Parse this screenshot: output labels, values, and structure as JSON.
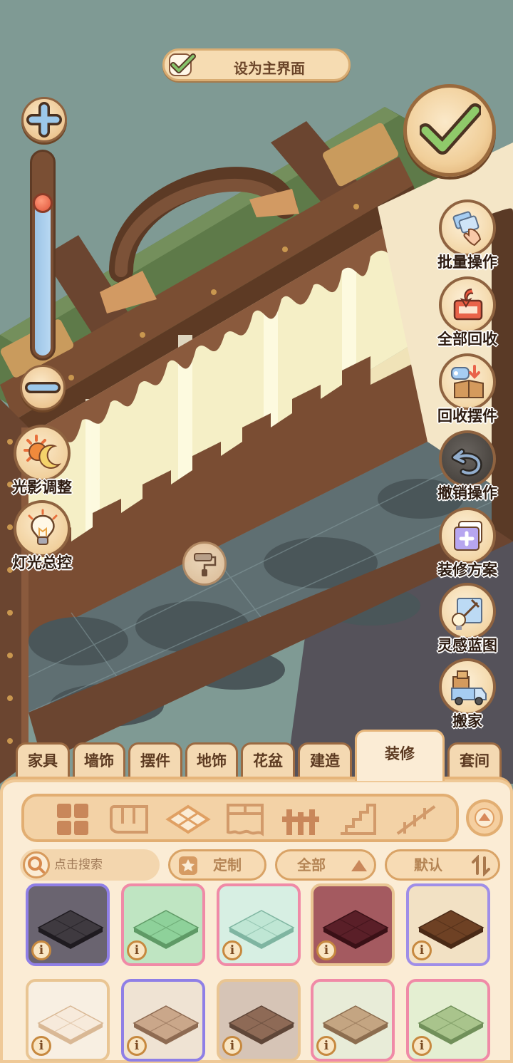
{
  "header": {
    "set_main_label": "设为主界面"
  },
  "zoom": {
    "level": 0.78
  },
  "left_tools": [
    {
      "label": "光影调整",
      "icon": "sun-moon-icon"
    },
    {
      "label": "灯光总控",
      "icon": "lightbulb-icon"
    }
  ],
  "right_tools": [
    {
      "label": "批量操作",
      "icon": "batch-hand-icon"
    },
    {
      "label": "全部回收",
      "icon": "recycle-all-icon"
    },
    {
      "label": "回收摆件",
      "icon": "recycle-decor-icon"
    },
    {
      "label": "撤销操作",
      "icon": "undo-icon"
    },
    {
      "label": "装修方案",
      "icon": "plan-card-icon"
    },
    {
      "label": "灵感蓝图",
      "icon": "blueprint-icon"
    },
    {
      "label": "搬家",
      "icon": "moving-truck-icon"
    }
  ],
  "tabs": [
    {
      "label": "家具"
    },
    {
      "label": "墙饰"
    },
    {
      "label": "摆件"
    },
    {
      "label": "地饰"
    },
    {
      "label": "花盆"
    },
    {
      "label": "建造"
    },
    {
      "label": "装修",
      "active": true
    },
    {
      "label": "套间"
    }
  ],
  "categories": [
    {
      "icon": "all-grid-icon"
    },
    {
      "icon": "wallpaper-icon"
    },
    {
      "icon": "floor-tile-icon",
      "selected": true
    },
    {
      "icon": "window-icon"
    },
    {
      "icon": "fence-icon"
    },
    {
      "icon": "stairs-icon"
    },
    {
      "icon": "railing-icon"
    }
  ],
  "filters": {
    "search_placeholder": "点击搜索",
    "custom_label": "定制",
    "scope_label": "全部",
    "sort_label": "默认"
  },
  "items": [
    {
      "icon": "dark-stone-floor-icon",
      "info": "i",
      "top": "#3f3a40",
      "side": "#1f1b20",
      "bg": "#6a6470",
      "frame": "#8f7fe6"
    },
    {
      "icon": "green-meadow-floor-icon",
      "info": "i",
      "top": "#8ed19a",
      "side": "#5f9a66",
      "bg": "#bfe5c2",
      "frame": "#f08aa7"
    },
    {
      "icon": "mint-pattern-floor-icon",
      "info": "i",
      "top": "#bfe6d4",
      "side": "#7fb5a1",
      "bg": "#d7efe3",
      "frame": "#f08aa7"
    },
    {
      "icon": "burgundy-floor-icon",
      "info": "i",
      "top": "#5a1f28",
      "side": "#3a1016",
      "bg": "#a45a60",
      "frame": "#e9c593"
    },
    {
      "icon": "wood-plank-floor-icon",
      "info": "i",
      "top": "#6e4124",
      "side": "#4a2a16",
      "bg": "#f2e1c4",
      "frame": "#9f8ee8"
    },
    {
      "icon": "cream-tile-floor-icon",
      "info": "i",
      "top": "#f7eadb",
      "side": "#d9b895",
      "bg": "#f8efe2",
      "frame": "#e9c593"
    },
    {
      "icon": "beige-checker-floor-icon",
      "info": "i",
      "top": "#caa78a",
      "side": "#8e6b52",
      "bg": "#efe3d3",
      "frame": "#8f7fe6"
    },
    {
      "icon": "ornate-tile-floor-icon",
      "info": "i",
      "top": "#8e6a56",
      "side": "#5f4638",
      "bg": "#d6c4b6",
      "frame": "#e9c593"
    },
    {
      "icon": "herringbone-floor-icon",
      "info": "i",
      "top": "#c4a582",
      "side": "#8c6d4f",
      "bg": "#e8ecd8",
      "frame": "#f08aa7"
    },
    {
      "icon": "green-brick-floor-icon",
      "info": "i",
      "top": "#a9c48c",
      "side": "#71905a",
      "bg": "#e4efd2",
      "frame": "#f08aa7"
    }
  ]
}
